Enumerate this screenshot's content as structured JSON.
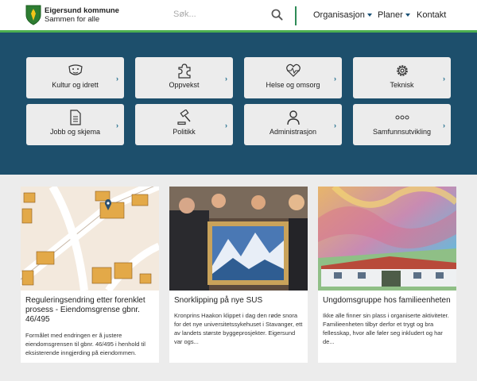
{
  "header": {
    "logo_name": "Eigersund kommune",
    "logo_tagline": "Sammen for alle",
    "search_placeholder": "Søk...",
    "nav": [
      "Organisasjon",
      "Planer",
      "Kontakt"
    ],
    "accent_color": "#4caf50"
  },
  "tiles": [
    {
      "label": "Kultur og idrett",
      "icon": "theater-masks-icon"
    },
    {
      "label": "Oppvekst",
      "icon": "puzzle-icon"
    },
    {
      "label": "Helse og omsorg",
      "icon": "heart-pulse-icon"
    },
    {
      "label": "Teknisk",
      "icon": "gear-icon"
    },
    {
      "label": "Jobb og skjema",
      "icon": "document-icon"
    },
    {
      "label": "Politikk",
      "icon": "gavel-icon"
    },
    {
      "label": "Administrasjon",
      "icon": "person-icon"
    },
    {
      "label": "Samfunnsutvikling",
      "icon": "dots-icon"
    }
  ],
  "cards": [
    {
      "title": "Reguleringsendring etter forenklet prosess - Eiendomsgrense gbnr. 46/495",
      "text": "Formålet med endringen er å justere eiendomsgrensen til gbnr. 46/495 i henhold til eksisterende inngjerding på eiendommen.",
      "image": "map-image"
    },
    {
      "title": "Snorklipping på nye SUS",
      "text": "Kronprins Haakon klippet i dag den røde snora for det nye universitetssykehuset i Stavanger, ett av landets største byggeprosjekter. Eigersund var ogs...",
      "image": "ribbon-cutting-photo"
    },
    {
      "title": "Ungdomsgruppe hos familieenheten",
      "text": "Ikke alle finner sin plass i organiserte aktiviteter. Familieenheten tilbyr derfor et trygt og bra fellesskap, hvor alle føler seg inkludert og har de...",
      "image": "painted-building-photo"
    }
  ]
}
